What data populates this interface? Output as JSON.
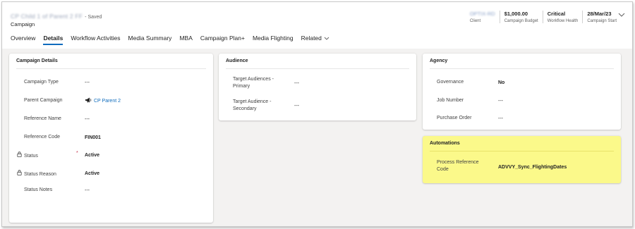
{
  "header": {
    "record_title": "CP Child 1 of Parent 2 FF",
    "saved_status": "- Saved",
    "entity_type": "Campaign",
    "fields": [
      {
        "value": "OPTIX-RD",
        "label": "Client"
      },
      {
        "value": "$1,000.00",
        "label": "Campaign Budget"
      },
      {
        "value": "Critical",
        "label": "Workflow Health"
      },
      {
        "value": "28/Mar/23",
        "label": "Campaign Start"
      }
    ],
    "expand_icon": "chevron-down-icon"
  },
  "tabs": [
    {
      "label": "Overview"
    },
    {
      "label": "Details",
      "active": true
    },
    {
      "label": "Workflow Activities"
    },
    {
      "label": "Media Summary"
    },
    {
      "label": "MBA"
    },
    {
      "label": "Campaign Plan+"
    },
    {
      "label": "Media Flighting"
    },
    {
      "label": "Related"
    }
  ],
  "campaign_details": {
    "title": "Campaign Details",
    "fields": [
      {
        "label": "Campaign Type",
        "value": "---"
      },
      {
        "label": "Parent Campaign",
        "value": "CP Parent 2"
      },
      {
        "label": "Reference Name",
        "value": "---"
      },
      {
        "label": "Reference Code",
        "value": "FIN001"
      },
      {
        "label": "Status",
        "value": "Active",
        "required": "*"
      },
      {
        "label": "Status Reason",
        "value": "Active"
      },
      {
        "label": "Status Notes",
        "value": "---"
      }
    ]
  },
  "audience": {
    "title": "Audience",
    "fields": [
      {
        "label_line1": "Target Audiences -",
        "label_line2": "Primary",
        "value": "---"
      },
      {
        "label_line1": "Target Audience -",
        "label_line2": "Secondary",
        "value": "---"
      }
    ]
  },
  "agency": {
    "title": "Agency",
    "fields": [
      {
        "label": "Governance",
        "value": "No"
      },
      {
        "label": "Job Number",
        "value": "---"
      },
      {
        "label": "Purchase Order",
        "value": "---"
      }
    ]
  },
  "automations": {
    "title": "Automations",
    "fields": [
      {
        "label_line1": "Process Reference",
        "label_line2": "Code",
        "value": "ADVVY_Sync_FlightingDates"
      }
    ]
  },
  "colors": {
    "accent": "#0f6cbd",
    "highlight": "#fbf98a",
    "background": "#f3f2f1"
  }
}
